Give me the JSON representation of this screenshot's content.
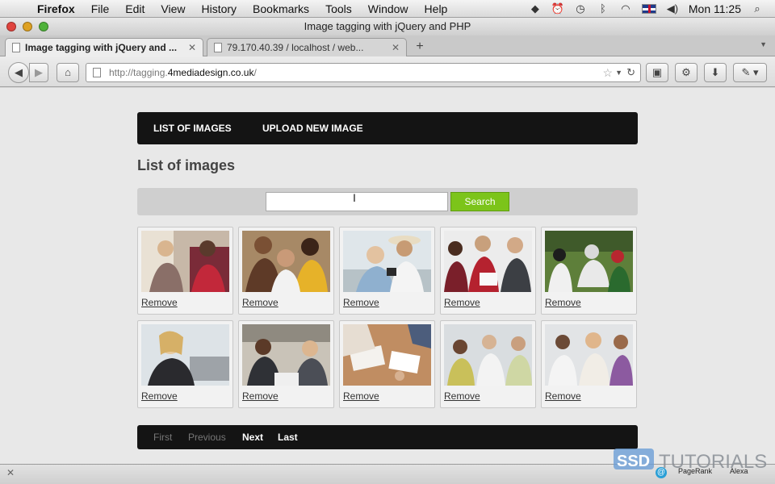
{
  "menubar": {
    "app_name": "Firefox",
    "menus": [
      "File",
      "Edit",
      "View",
      "History",
      "Bookmarks",
      "Tools",
      "Window",
      "Help"
    ],
    "status_icons": [
      "dropbox-icon",
      "alarm-icon",
      "time-machine-icon",
      "bluetooth-icon",
      "wifi-icon",
      "uk-flag-icon",
      "volume-icon"
    ],
    "clock": "Mon 11:25"
  },
  "window": {
    "title": "Image tagging with jQuery and PHP"
  },
  "tabs": [
    {
      "label": "Image tagging with jQuery and ...",
      "active": true
    },
    {
      "label": "79.170.40.39 / localhost / web...",
      "active": false
    }
  ],
  "address": {
    "url_prefix": "http://tagging.",
    "url_host": "4mediadesign.co.uk",
    "url_suffix": "/"
  },
  "site": {
    "nav": [
      "LIST OF IMAGES",
      "UPLOAD NEW IMAGE"
    ],
    "heading": "List of images",
    "search": {
      "value": "",
      "button_label": "Search",
      "button_color": "#7cc41a"
    },
    "cards": [
      {
        "remove_label": "Remove"
      },
      {
        "remove_label": "Remove"
      },
      {
        "remove_label": "Remove"
      },
      {
        "remove_label": "Remove"
      },
      {
        "remove_label": "Remove"
      },
      {
        "remove_label": "Remove"
      },
      {
        "remove_label": "Remove"
      },
      {
        "remove_label": "Remove"
      },
      {
        "remove_label": "Remove"
      },
      {
        "remove_label": "Remove"
      }
    ],
    "pagination": [
      {
        "label": "First",
        "enabled": false
      },
      {
        "label": "Previous",
        "enabled": false
      },
      {
        "label": "Next",
        "enabled": true
      },
      {
        "label": "Last",
        "enabled": true
      }
    ]
  },
  "statusbar": {
    "pagerank_label": "PageRank",
    "alexa_label": "Alexa"
  },
  "watermark": {
    "brand": "SSD",
    "text": "TUTORIALS"
  }
}
